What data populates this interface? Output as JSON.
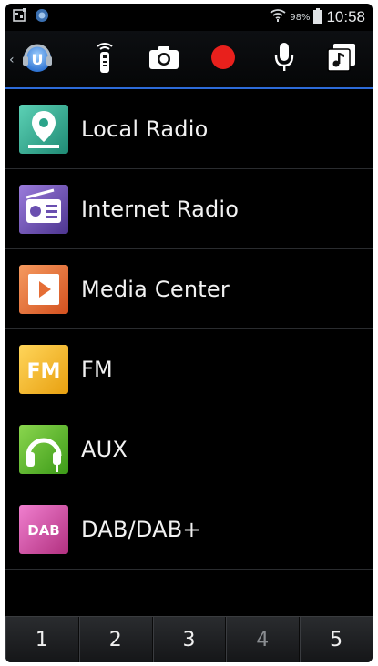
{
  "status_bar": {
    "time": "10:58",
    "battery_percent": "98%"
  },
  "toolbar": {
    "icons": [
      "app-logo-icon",
      "remote-icon",
      "camera-icon",
      "record-icon",
      "microphone-icon",
      "music-library-icon"
    ],
    "record_color": "#e8201c"
  },
  "sources": [
    {
      "label": "Local Radio",
      "icon": "local-radio-icon",
      "color": "#2aa48a"
    },
    {
      "label": "Internet Radio",
      "icon": "internet-radio-icon",
      "color": "#6a4fb0"
    },
    {
      "label": "Media Center",
      "icon": "media-center-icon",
      "color": "#e56d35"
    },
    {
      "label": "FM",
      "icon": "fm-icon",
      "color": "#f2b01e"
    },
    {
      "label": "AUX",
      "icon": "aux-icon",
      "color": "#5ab82a"
    },
    {
      "label": "DAB/DAB+",
      "icon": "dab-icon",
      "color": "#d14aa4",
      "tile_text": "DAB"
    }
  ],
  "fm_tile_text": "FM",
  "presets": [
    {
      "label": "1"
    },
    {
      "label": "2"
    },
    {
      "label": "3"
    },
    {
      "label": "4",
      "dim": true
    },
    {
      "label": "5"
    }
  ]
}
